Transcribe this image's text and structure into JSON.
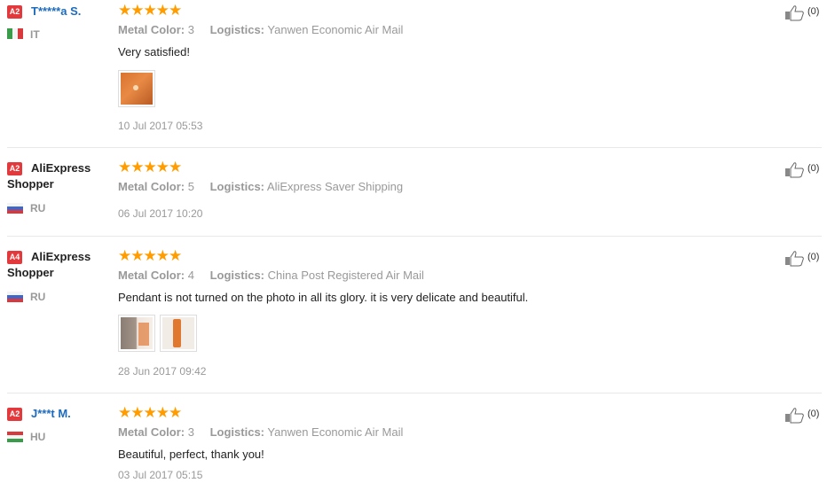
{
  "labels": {
    "metal_color": "Metal Color:",
    "logistics": "Logistics:",
    "stars": "★★★★★"
  },
  "reviews": [
    {
      "badge": "A2",
      "name": "T*****a S.",
      "country": "IT",
      "metal_color": "3",
      "logistics": "Yanwen Economic Air Mail",
      "text": "Very satisfied!",
      "date": "10 Jul 2017 05:53",
      "helpful": "(0)",
      "rating": 5
    },
    {
      "badge": "A2",
      "name": "AliExpress Shopper",
      "country": "RU",
      "metal_color": "5",
      "logistics": "AliExpress Saver Shipping",
      "text": "",
      "date": "06 Jul 2017 10:20",
      "helpful": "(0)",
      "rating": 5
    },
    {
      "badge": "A4",
      "name": "AliExpress Shopper",
      "country": "RU",
      "metal_color": "4",
      "logistics": "China Post Registered Air Mail",
      "text": "Pendant is not turned on the photo in all its glory. it is very delicate and beautiful.",
      "date": "28 Jun 2017 09:42",
      "helpful": "(0)",
      "rating": 5
    },
    {
      "badge": "A2",
      "name": "J***t M.",
      "country": "HU",
      "metal_color": "3",
      "logistics": "Yanwen Economic Air Mail",
      "text": "Beautiful, perfect, thank you!",
      "date": "03 Jul 2017 05:15",
      "helpful": "(0)",
      "rating": 5
    }
  ],
  "colors": {
    "star": "#ff9d00",
    "badge": "#e4393c",
    "link": "#1c6bbd"
  }
}
